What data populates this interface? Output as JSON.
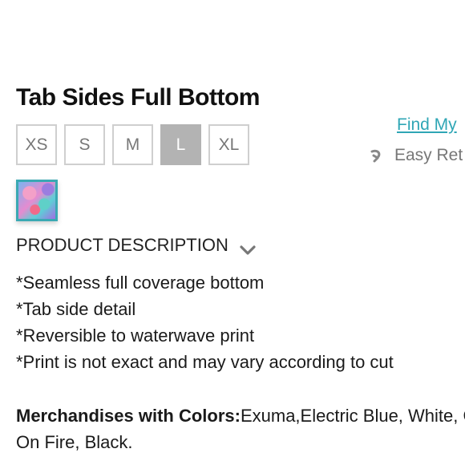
{
  "product": {
    "title": "Tab Sides Full Bottom",
    "sizes": [
      "XS",
      "S",
      "M",
      "L",
      "XL"
    ],
    "selected_size": "L",
    "swatch_icon": "print-swatch"
  },
  "links": {
    "find_my_size": "Find My",
    "easy_returns": "Easy Ret"
  },
  "description": {
    "header": "PRODUCT DESCRIPTION",
    "features": [
      "*Seamless full coverage bottom",
      "*Tab side detail",
      "*Reversible to waterwave print",
      "*Print is not exact and may vary according to cut"
    ],
    "colors_label": "Merchandises with Colors:",
    "colors_value": "Exuma,Electric Blue, White, G",
    "colors_value_line2": "On Fire, Black."
  },
  "colors": {
    "accent": "#2fa6b5",
    "selected_size_bg": "#b3b3b3",
    "size_border": "#cfcfcf"
  }
}
